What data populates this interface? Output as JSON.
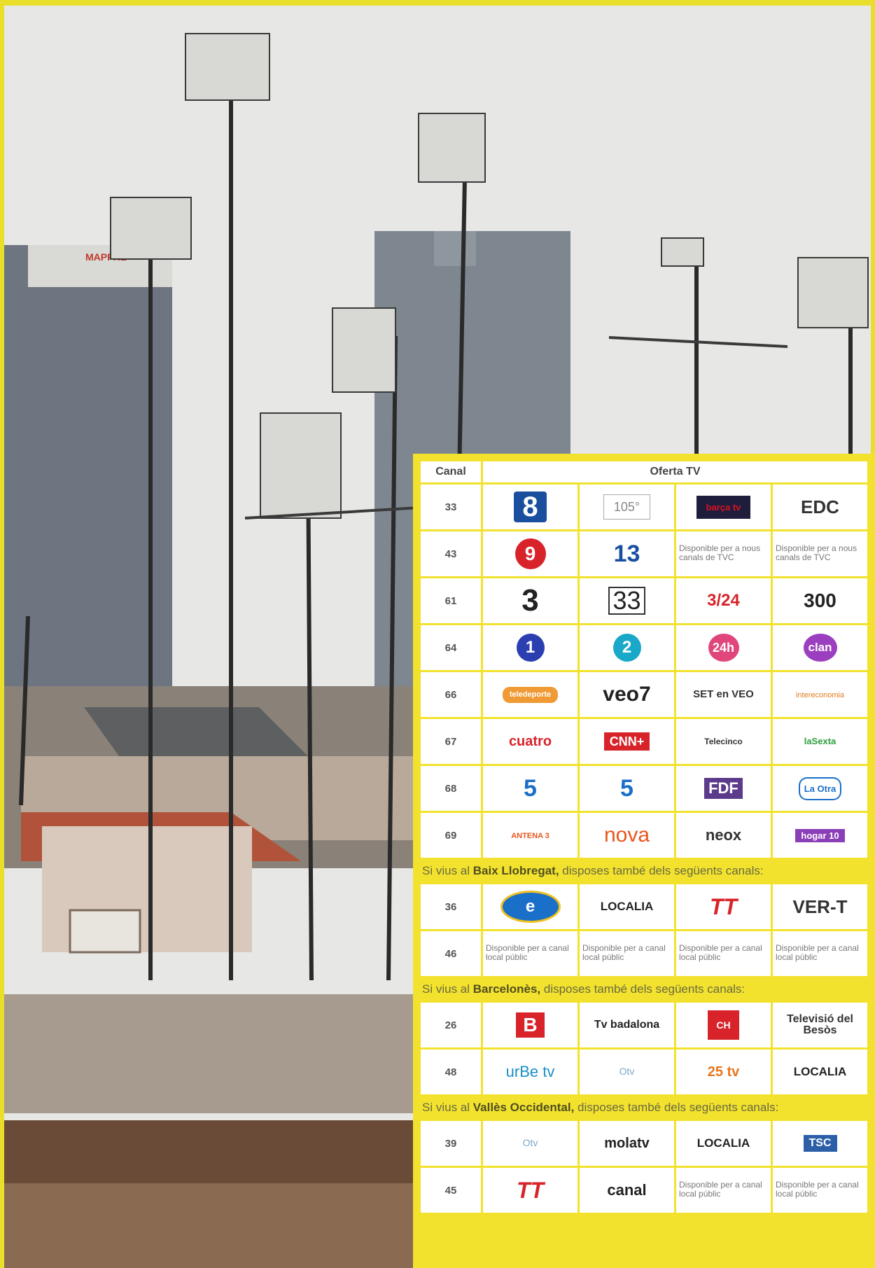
{
  "table": {
    "header": {
      "channel": "Canal",
      "offer": "Oferta TV"
    },
    "main_rows": [
      {
        "channel": "33",
        "cells": [
          "8",
          "105°",
          "barça tv",
          "EDC"
        ]
      },
      {
        "channel": "43",
        "cells": [
          "9",
          "13",
          "Disponible per a nous canals de TVC",
          "Disponible per a nous canals de TVC"
        ]
      },
      {
        "channel": "61",
        "cells": [
          "3",
          "33",
          "3/24",
          "300"
        ]
      },
      {
        "channel": "64",
        "cells": [
          "1",
          "2",
          "24h",
          "clan"
        ]
      },
      {
        "channel": "66",
        "cells": [
          "teledeporte",
          "veo7",
          "SET en VEO",
          "intereconomia"
        ]
      },
      {
        "channel": "67",
        "cells": [
          "cuatro",
          "CNN+",
          "Telecinco",
          "laSexta"
        ]
      },
      {
        "channel": "68",
        "cells": [
          "5",
          "5",
          "FDF",
          "La Otra"
        ]
      },
      {
        "channel": "69",
        "cells": [
          "ANTENA 3",
          "nova",
          "neox",
          "hogar 10"
        ]
      }
    ],
    "sections": [
      {
        "prefix": "Si vius al ",
        "region": "Baix Llobregat,",
        "suffix": " disposes també dels següents canals:",
        "rows": [
          {
            "channel": "36",
            "cells": [
              "e",
              "LOCALIA",
              "TT",
              "VER-T"
            ]
          },
          {
            "channel": "46",
            "cells": [
              "Disponible per a canal local públic",
              "Disponible per a canal local públic",
              "Disponible per a canal local públic",
              "Disponible per a canal local públic"
            ]
          }
        ]
      },
      {
        "prefix": "Si vius al ",
        "region": "Barcelonès,",
        "suffix": " disposes també dels següents canals:",
        "rows": [
          {
            "channel": "26",
            "cells": [
              "B",
              "Tv badalona",
              "CH",
              "Televisió del Besòs"
            ]
          },
          {
            "channel": "48",
            "cells": [
              "urBe tv",
              "Otv",
              "25 tv",
              "LOCALIA"
            ]
          }
        ]
      },
      {
        "prefix": "Si vius al ",
        "region": "Vallès Occidental,",
        "suffix": " disposes també dels següents canals:",
        "rows": [
          {
            "channel": "39",
            "cells": [
              "Otv",
              "molatv",
              "LOCALIA",
              "TSC"
            ]
          },
          {
            "channel": "45",
            "cells": [
              "TT",
              "canal",
              "Disponible per a canal local públic",
              "Disponible per a canal local públic"
            ]
          }
        ]
      }
    ]
  },
  "photo": {
    "building_sign": "MAPFRE"
  },
  "colors": {
    "frame": "#e9df2a",
    "panel": "#f2e22e",
    "sky": "#e7e7e5"
  }
}
